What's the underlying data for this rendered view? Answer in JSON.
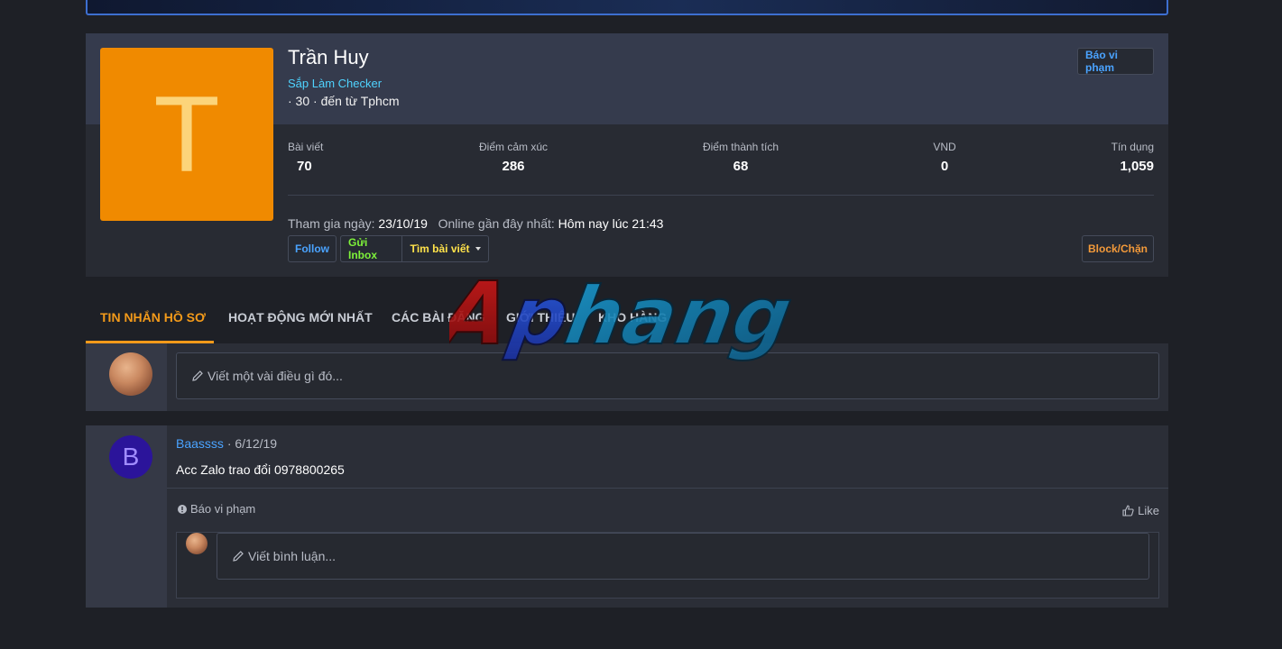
{
  "profile": {
    "avatar_letter": "T",
    "name": "Trần Huy",
    "title": "Sắp Làm Checker",
    "info": "· 30 · đến từ Tphcm",
    "report_label": "Báo vi phạm",
    "block_label": "Block/Chặn",
    "stats": [
      {
        "label": "Bài viết",
        "value": "70"
      },
      {
        "label": "Điểm cảm xúc",
        "value": "286"
      },
      {
        "label": "Điểm thành tích",
        "value": "68"
      },
      {
        "label": "VND",
        "value": "0"
      },
      {
        "label": "Tín dụng",
        "value": "1,059"
      }
    ],
    "join_label": "Tham gia ngày:",
    "join_date": "23/10/19",
    "online_label": "Online gần đây nhất:",
    "online_value": "Hôm nay lúc 21:43",
    "follow_label": "Follow",
    "inbox_label": "Gửi Inbox",
    "find_posts_label": "Tìm bài viết"
  },
  "tabs": [
    {
      "label": "TIN NHẮN HỒ SƠ",
      "active": true
    },
    {
      "label": "HOẠT ĐỘNG MỚI NHẤT",
      "active": false
    },
    {
      "label": "CÁC BÀI ĐĂNG",
      "active": false
    },
    {
      "label": "GIỚI THIỆU",
      "active": false
    },
    {
      "label": "KHO HÀNG",
      "active": false
    }
  ],
  "composer": {
    "placeholder": "Viết một vài điều gì đó..."
  },
  "message": {
    "avatar_letter": "B",
    "author": "Baassss",
    "date": "· 6/12/19",
    "body": "Acc Zalo trao đổi 0978800265",
    "report_label": "Báo vi phạm",
    "like_label": "Like",
    "comment_placeholder": "Viết bình luận..."
  },
  "watermark": {
    "text": "Aphang"
  },
  "colors": {
    "accent_orange": "#f39a1a",
    "link_blue": "#4aa3ff",
    "title_cyan": "#4fd3ff",
    "inbox_green": "#7ef23a",
    "find_yellow": "#ffe24a",
    "avatar_orange": "#f08a00"
  }
}
